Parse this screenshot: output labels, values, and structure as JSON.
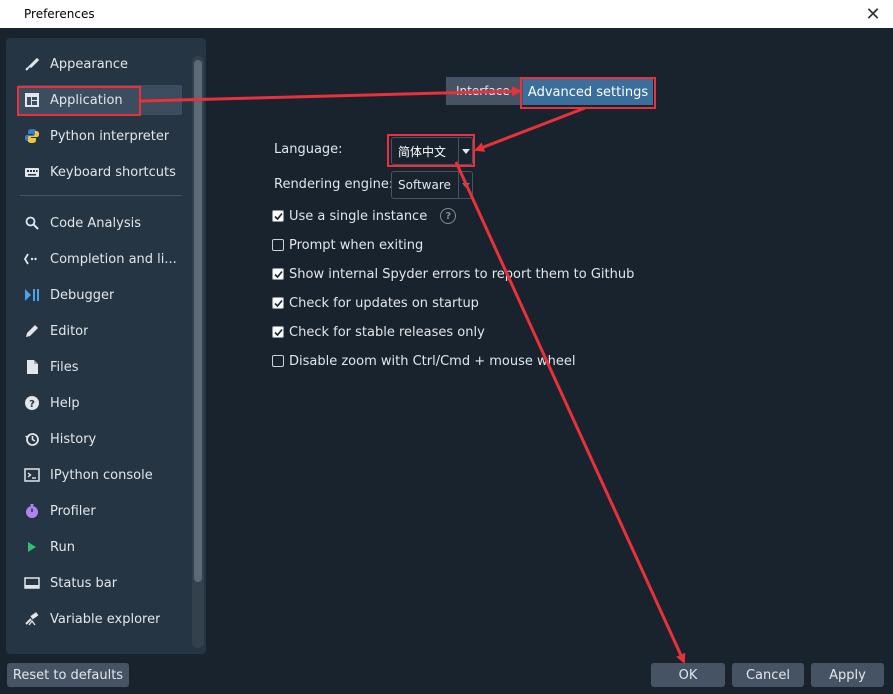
{
  "window": {
    "title": "Preferences",
    "close_glyph": "✕"
  },
  "sidebar": {
    "items": [
      {
        "label": "Appearance",
        "icon": "brush-icon"
      },
      {
        "label": "Application",
        "icon": "application-icon"
      },
      {
        "label": "Python interpreter",
        "icon": "python-icon"
      },
      {
        "label": "Keyboard shortcuts",
        "icon": "keyboard-icon"
      },
      {
        "label": "Code Analysis",
        "icon": "code-analysis-icon"
      },
      {
        "label": "Completion and li...",
        "icon": "completion-icon"
      },
      {
        "label": "Debugger",
        "icon": "debugger-icon"
      },
      {
        "label": "Editor",
        "icon": "editor-icon"
      },
      {
        "label": "Files",
        "icon": "files-icon"
      },
      {
        "label": "Help",
        "icon": "help-icon"
      },
      {
        "label": "History",
        "icon": "history-icon"
      },
      {
        "label": "IPython console",
        "icon": "console-icon"
      },
      {
        "label": "Profiler",
        "icon": "profiler-icon"
      },
      {
        "label": "Run",
        "icon": "run-icon"
      },
      {
        "label": "Status bar",
        "icon": "status-bar-icon"
      },
      {
        "label": "Variable explorer",
        "icon": "variable-explorer-icon"
      }
    ],
    "selected": "Application"
  },
  "tabs": [
    {
      "label": "Interface",
      "active": false
    },
    {
      "label": "Advanced settings",
      "active": true
    }
  ],
  "form": {
    "language_label": "Language:",
    "language_value": "简体中文",
    "engine_label": "Rendering engine:",
    "engine_value": "Software",
    "options": [
      {
        "label": "Use a single instance",
        "checked": true,
        "help": true
      },
      {
        "label": "Prompt when exiting",
        "checked": false
      },
      {
        "label": "Show internal Spyder errors to report them to Github",
        "checked": true
      },
      {
        "label": "Check for updates on startup",
        "checked": true
      },
      {
        "label": "Check for stable releases only",
        "checked": true
      },
      {
        "label": "Disable zoom with Ctrl/Cmd + mouse wheel",
        "checked": false
      }
    ],
    "help_glyph": "?"
  },
  "buttons": {
    "reset": "Reset to defaults",
    "ok": "OK",
    "cancel": "Cancel",
    "apply": "Apply"
  },
  "colors": {
    "background": "#19232d",
    "sidebar": "#253544",
    "selected_tab": "#3a6f9c",
    "annotation": "#e8313a"
  }
}
